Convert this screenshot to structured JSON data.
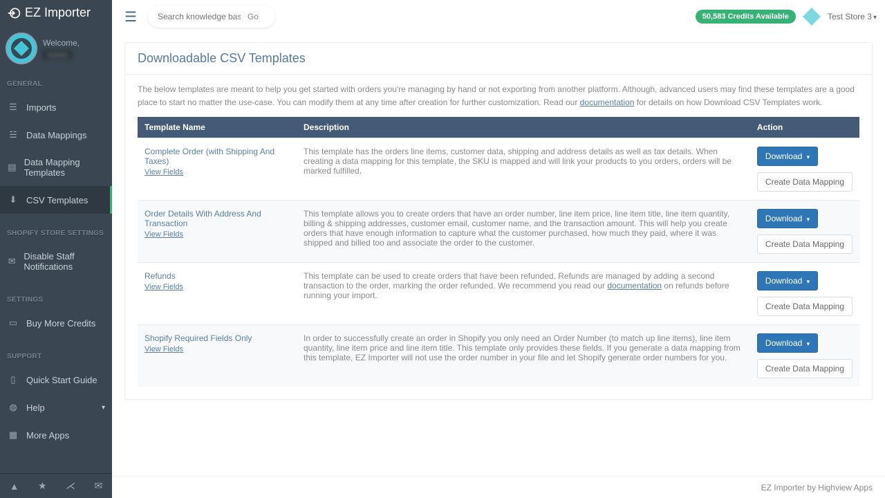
{
  "app": {
    "name": "EZ Importer"
  },
  "welcome": {
    "greeting": "Welcome,",
    "name_masked": "xxxxx"
  },
  "sidebar": {
    "general_heading": "GENERAL",
    "shopify_heading": "SHOPIFY STORE SETTINGS",
    "settings_heading": "SETTINGS",
    "support_heading": "SUPPORT",
    "imports": "Imports",
    "data_mappings": "Data Mappings",
    "dm_templates": "Data Mapping Templates",
    "csv_templates": "CSV Templates",
    "disable_notif": "Disable Staff Notifications",
    "buy_credits": "Buy More Credits",
    "quick_start": "Quick Start Guide",
    "help": "Help",
    "more_apps": "More Apps"
  },
  "topbar": {
    "search_placeholder": "Search knowledge base...",
    "go": "Go",
    "credits": "50,583 Credits Available",
    "store": "Test Store 3"
  },
  "page": {
    "title": "Downloadable CSV Templates",
    "intro_a": "The below templates are meant to help you get started with orders you're managing by hand or not exporting from another platform. Although, advanced users may find these templates are a good place to start no matter the use-case. You can modify them at any time after creation for further customization. Read our ",
    "intro_link": "documentation",
    "intro_b": " for details on how Download CSV Templates work."
  },
  "table": {
    "h1": "Template Name",
    "h2": "Description",
    "h3": "Action",
    "view_fields": "View Fields",
    "download": "Download",
    "create_mapping": "Create Data Mapping",
    "rows": [
      {
        "name": "Complete Order (with Shipping And Taxes)",
        "desc": "This template has the orders line items, customer data, shipping and address details as well as tax details. When creating a data mapping for this template, the SKU is mapped and will link your products to you orders, orders will be marked fulfilled."
      },
      {
        "name": "Order Details With Address And Transaction",
        "desc": "This template allows you to create orders that have an order number, line item price, line item title, line item quantity, billing & shipping addresses, customer email, customer name, and the transaction amount. This will help you create orders that have enough information to capture what the customer purchased, how much they paid, where it was shipped and billed too and associate the order to the customer."
      },
      {
        "name": "Refunds",
        "desc_a": "This template can be used to create orders that have been refunded. Refunds are managed by adding a second transaction to the order, marking the order refunded. We recommend you read our ",
        "desc_link": "documentation",
        "desc_b": " on refunds before running your import."
      },
      {
        "name": "Shopify Required Fields Only",
        "desc": "In order to successfully create an order in Shopify you only need an Order Number (to match up line items), line item quantity, line item price and line item title. This template only provides these fields. If you generate a data mapping from this template, EZ Importer will not use the order number in your file and let Shopify generate order numbers for you."
      }
    ]
  },
  "footer": {
    "text": "EZ Importer by Highview Apps"
  }
}
